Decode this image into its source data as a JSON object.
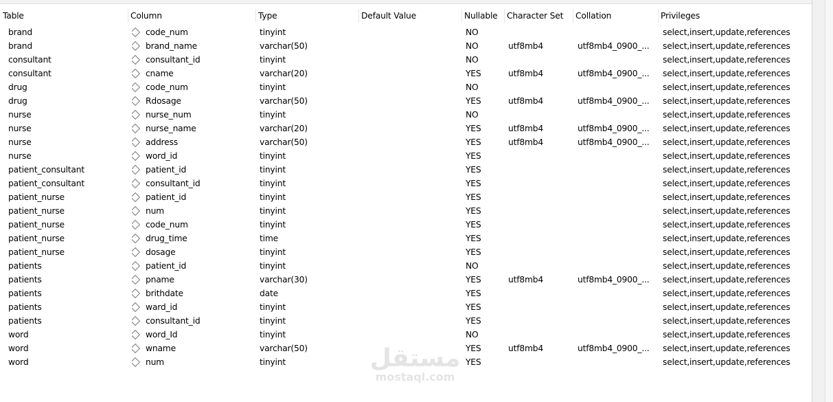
{
  "headers": {
    "table": "Table",
    "column": "Column",
    "type": "Type",
    "default": "Default Value",
    "nullable": "Nullable",
    "charset": "Character Set",
    "collation": "Collation",
    "privileges": "Privileges"
  },
  "rows": [
    {
      "table": "brand",
      "column": "code_num",
      "type": "tinyint",
      "default": "",
      "nullable": "NO",
      "charset": "",
      "collation": "",
      "privileges": "select,insert,update,references"
    },
    {
      "table": "brand",
      "column": "brand_name",
      "type": "varchar(50)",
      "default": "",
      "nullable": "NO",
      "charset": "utf8mb4",
      "collation": "utf8mb4_0900_...",
      "privileges": "select,insert,update,references"
    },
    {
      "table": "consultant",
      "column": "consultant_id",
      "type": "tinyint",
      "default": "",
      "nullable": "NO",
      "charset": "",
      "collation": "",
      "privileges": "select,insert,update,references"
    },
    {
      "table": "consultant",
      "column": "cname",
      "type": "varchar(20)",
      "default": "",
      "nullable": "YES",
      "charset": "utf8mb4",
      "collation": "utf8mb4_0900_...",
      "privileges": "select,insert,update,references"
    },
    {
      "table": "drug",
      "column": "code_num",
      "type": "tinyint",
      "default": "",
      "nullable": "NO",
      "charset": "",
      "collation": "",
      "privileges": "select,insert,update,references"
    },
    {
      "table": "drug",
      "column": "Rdosage",
      "type": "varchar(50)",
      "default": "",
      "nullable": "YES",
      "charset": "utf8mb4",
      "collation": "utf8mb4_0900_...",
      "privileges": "select,insert,update,references"
    },
    {
      "table": "nurse",
      "column": "nurse_num",
      "type": "tinyint",
      "default": "",
      "nullable": "NO",
      "charset": "",
      "collation": "",
      "privileges": "select,insert,update,references"
    },
    {
      "table": "nurse",
      "column": "nurse_name",
      "type": "varchar(20)",
      "default": "",
      "nullable": "YES",
      "charset": "utf8mb4",
      "collation": "utf8mb4_0900_...",
      "privileges": "select,insert,update,references"
    },
    {
      "table": "nurse",
      "column": "address",
      "type": "varchar(50)",
      "default": "",
      "nullable": "YES",
      "charset": "utf8mb4",
      "collation": "utf8mb4_0900_...",
      "privileges": "select,insert,update,references"
    },
    {
      "table": "nurse",
      "column": "word_id",
      "type": "tinyint",
      "default": "",
      "nullable": "YES",
      "charset": "",
      "collation": "",
      "privileges": "select,insert,update,references"
    },
    {
      "table": "patient_consultant",
      "column": "patient_id",
      "type": "tinyint",
      "default": "",
      "nullable": "YES",
      "charset": "",
      "collation": "",
      "privileges": "select,insert,update,references"
    },
    {
      "table": "patient_consultant",
      "column": "consultant_id",
      "type": "tinyint",
      "default": "",
      "nullable": "YES",
      "charset": "",
      "collation": "",
      "privileges": "select,insert,update,references"
    },
    {
      "table": "patient_nurse",
      "column": "patient_id",
      "type": "tinyint",
      "default": "",
      "nullable": "YES",
      "charset": "",
      "collation": "",
      "privileges": "select,insert,update,references"
    },
    {
      "table": "patient_nurse",
      "column": "num",
      "type": "tinyint",
      "default": "",
      "nullable": "YES",
      "charset": "",
      "collation": "",
      "privileges": "select,insert,update,references"
    },
    {
      "table": "patient_nurse",
      "column": "code_num",
      "type": "tinyint",
      "default": "",
      "nullable": "YES",
      "charset": "",
      "collation": "",
      "privileges": "select,insert,update,references"
    },
    {
      "table": "patient_nurse",
      "column": "drug_time",
      "type": "time",
      "default": "",
      "nullable": "YES",
      "charset": "",
      "collation": "",
      "privileges": "select,insert,update,references"
    },
    {
      "table": "patient_nurse",
      "column": "dosage",
      "type": "tinyint",
      "default": "",
      "nullable": "YES",
      "charset": "",
      "collation": "",
      "privileges": "select,insert,update,references"
    },
    {
      "table": "patients",
      "column": "patient_id",
      "type": "tinyint",
      "default": "",
      "nullable": "NO",
      "charset": "",
      "collation": "",
      "privileges": "select,insert,update,references"
    },
    {
      "table": "patients",
      "column": "pname",
      "type": "varchar(30)",
      "default": "",
      "nullable": "YES",
      "charset": "utf8mb4",
      "collation": "utf8mb4_0900_...",
      "privileges": "select,insert,update,references"
    },
    {
      "table": "patients",
      "column": "brithdate",
      "type": "date",
      "default": "",
      "nullable": "YES",
      "charset": "",
      "collation": "",
      "privileges": "select,insert,update,references"
    },
    {
      "table": "patients",
      "column": "ward_id",
      "type": "tinyint",
      "default": "",
      "nullable": "YES",
      "charset": "",
      "collation": "",
      "privileges": "select,insert,update,references"
    },
    {
      "table": "patients",
      "column": "consultant_id",
      "type": "tinyint",
      "default": "",
      "nullable": "YES",
      "charset": "",
      "collation": "",
      "privileges": "select,insert,update,references"
    },
    {
      "table": "word",
      "column": "word_Id",
      "type": "tinyint",
      "default": "",
      "nullable": "NO",
      "charset": "",
      "collation": "",
      "privileges": "select,insert,update,references"
    },
    {
      "table": "word",
      "column": "wname",
      "type": "varchar(50)",
      "default": "",
      "nullable": "YES",
      "charset": "utf8mb4",
      "collation": "utf8mb4_0900_...",
      "privileges": "select,insert,update,references"
    },
    {
      "table": "word",
      "column": "num",
      "type": "tinyint",
      "default": "",
      "nullable": "YES",
      "charset": "",
      "collation": "",
      "privileges": "select,insert,update,references"
    }
  ],
  "column_icon": "column-diamond-icon",
  "watermark": {
    "arabic": "مستقل",
    "latin": "mostaql.com"
  },
  "colors": {
    "background": "#ffffff",
    "text": "#000000",
    "icon": "#7b7b7b",
    "watermark": "#e4e4e4"
  }
}
